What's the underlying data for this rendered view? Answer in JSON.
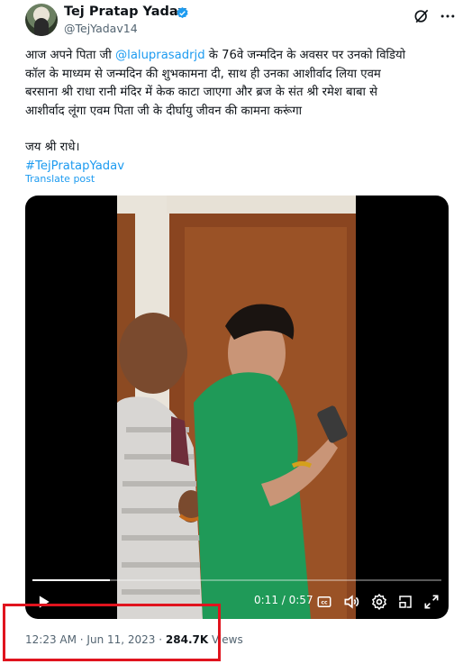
{
  "author": {
    "name": "Tej Pratap Yadav",
    "handle": "@TejYadav14",
    "verified": true,
    "avatar_icon": "avatar"
  },
  "tweet": {
    "line1_a": "आज अपने पिता जी ",
    "mention": "@laluprasadrjd",
    "line1_b": " के 76वे जन्मदिन के अवसर पर उनको विडियो",
    "line2": "कॉल के माध्यम से जन्मदिन की शुभकामना दी, साथ ही उनका आशीर्वाद लिया एवम",
    "line3": "बरसाना श्री राधा रानी मंदिर में केक काटा जाएगा और ब्रज के संत श्री रमेश बाबा से",
    "line4": "आशीर्वाद लूंगा एवम पिता जी के दीर्घायु जीवन की कामना करूंगा",
    "line5": "जय श्री राधे।",
    "hashtag": "#TejPratapYadav",
    "translate_label": "Translate post"
  },
  "video": {
    "current_time": "0:11",
    "separator": " / ",
    "duration": "0:57",
    "progress": 0.19,
    "controls": [
      "play-icon",
      "captions-icon",
      "volume-icon",
      "settings-icon",
      "picture-in-picture-icon",
      "fullscreen-icon"
    ]
  },
  "meta": {
    "time": "12:23 AM",
    "dot": " · ",
    "date": "Jun 11, 2023",
    "views_count": "284.7K",
    "views_label": " Views"
  },
  "colors": {
    "accent": "#1d9bf0",
    "text": "#0f1419",
    "secondary": "#536471",
    "highlight": "#e0141e"
  }
}
